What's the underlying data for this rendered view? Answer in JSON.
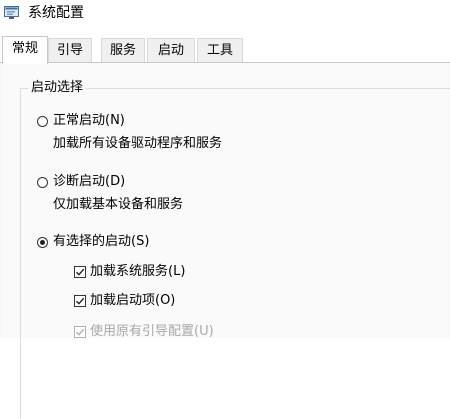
{
  "window": {
    "title": "系统配置",
    "icon": "msconfig-window-icon"
  },
  "tabs": [
    {
      "label": "常规",
      "active": true
    },
    {
      "label": "引导",
      "active": false
    },
    {
      "label": "服务",
      "active": false
    },
    {
      "label": "启动",
      "active": false
    },
    {
      "label": "工具",
      "active": false
    }
  ],
  "startup_selection": {
    "group_label": "启动选择",
    "options": [
      {
        "label": "正常启动(N)",
        "description": "加载所有设备驱动程序和服务",
        "selected": false
      },
      {
        "label": "诊断启动(D)",
        "description": "仅加载基本设备和服务",
        "selected": false
      },
      {
        "label": "有选择的启动(S)",
        "selected": true
      }
    ],
    "selective_items": [
      {
        "label": "加载系统服务(L)",
        "checked": true,
        "enabled": true
      },
      {
        "label": "加载启动项(O)",
        "checked": true,
        "enabled": true
      },
      {
        "label": "使用原有引导配置(U)",
        "checked": true,
        "enabled": false
      }
    ]
  }
}
